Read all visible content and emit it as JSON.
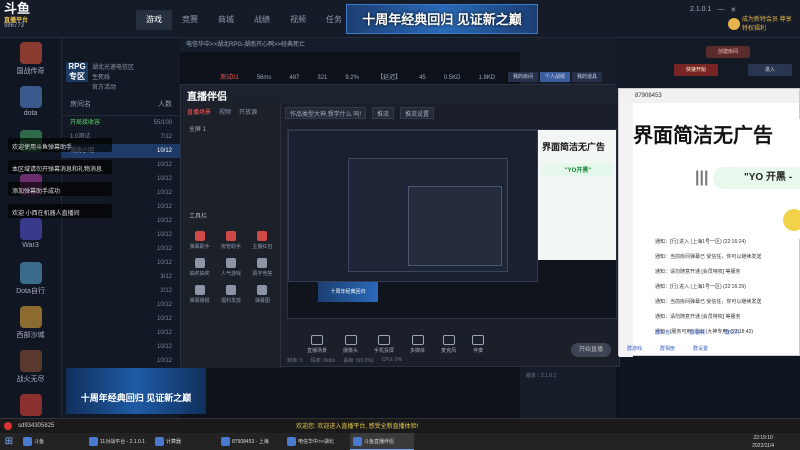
{
  "platform": {
    "logo_text": "斗鱼",
    "logo_sub": "直播平台",
    "user_id": "986773",
    "nav": [
      "",
      "",
      "游戏",
      "竞赛",
      "商城",
      "战绩",
      "视频",
      "任务"
    ],
    "active_nav_index": 2,
    "banner": "十周年经典回归 见证新之巅",
    "version": "2.1.0.1",
    "promo": "成为新特会员 尊享特权福利"
  },
  "games": [
    "国战传奇",
    "dota",
    "",
    "",
    "War3",
    "Dota自行",
    "西部沙城",
    "战火无尽",
    "传奇霸业"
  ],
  "rooms_top": {
    "badge": "RPG 专区",
    "line1": "湖北光速电信区",
    "line2": "生死线",
    "line3": "官方活动"
  },
  "rooms_header": {
    "name": "房间名",
    "count": "人数"
  },
  "rooms": [
    {
      "name": "开局接收容",
      "count": "55/100",
      "style": "green"
    },
    {
      "name": "1.0测试",
      "count": "7/12",
      "style": ""
    },
    {
      "name": "湖南小明",
      "count": "10/12",
      "style": "sel"
    },
    {
      "name": "",
      "count": "10/12",
      "style": ""
    },
    {
      "name": "",
      "count": "10/12",
      "style": ""
    },
    {
      "name": "",
      "count": "10/12",
      "style": ""
    },
    {
      "name": "",
      "count": "10/12",
      "style": ""
    },
    {
      "name": "",
      "count": "10/12",
      "style": ""
    },
    {
      "name": "",
      "count": "10/12",
      "style": ""
    },
    {
      "name": "",
      "count": "10/12",
      "style": ""
    },
    {
      "name": "",
      "count": "10/12",
      "style": ""
    },
    {
      "name": "",
      "count": "3/12",
      "style": ""
    },
    {
      "name": "",
      "count": "2/12",
      "style": ""
    },
    {
      "name": "",
      "count": "10/12",
      "style": ""
    },
    {
      "name": "",
      "count": "10/12",
      "style": ""
    },
    {
      "name": "",
      "count": "10/12",
      "style": ""
    },
    {
      "name": "",
      "count": "10/12",
      "style": ""
    },
    {
      "name": "",
      "count": "10/12",
      "style": ""
    }
  ],
  "chat": [
    "欢迎使用斗鱼弹幕助手",
    "本区域请勿开弹幕消息和礼物消息",
    "添加弹幕助手成功",
    "欢迎 小西在机器人直播间"
  ],
  "path_text": "电信华中>>湖北RPG-湖南开心鸭>>经典死亡",
  "status_bar": {
    "room": "测试01",
    "ping": "56ms",
    "a": "487",
    "b": "321",
    "c": "9.2%",
    "d": "【延迟】",
    "e": "45",
    "f": "0.5KD",
    "g": "1.8KD",
    "h": "254/秒"
  },
  "tool": {
    "logo": "直播伴侣",
    "tabs": [
      "直播场景",
      "视频",
      "开放源"
    ],
    "active_tab": 0,
    "scene": "全屏 1",
    "fields": [
      "作品类型大神,想学什么 吗!",
      "推流",
      "推流设置"
    ],
    "label_tools": "工具栏",
    "grid": [
      "弹幕助手",
      "房管助手",
      "主播红包",
      "抽奖抽奖",
      "人气游戏",
      "猜字竞答",
      "弹幕播报",
      "福利发放",
      "弹幕图"
    ],
    "bottom": [
      "直播场景",
      "摄像头",
      "手机投屏",
      "多媒体",
      "麦克风",
      "伴奏"
    ],
    "go_live": "开始直播",
    "stats": [
      "帧率: 0",
      "码率: 0kb/s",
      "丢帧: 0(0.0%)",
      "CPU: 0%"
    ]
  },
  "nested_ad": {
    "line": "界面简洁无广告",
    "pill": "\"YO开黑\""
  },
  "nested_banner": "十周年经典回归",
  "bottom_banner": "十周年经典回归 见证新之巅",
  "right_panel": {
    "tabs": [
      "我的房间",
      "个人战绩",
      "我的道具"
    ],
    "active_tab": 1,
    "version_text": "版本：2.1.0.1"
  },
  "wx": {
    "title": "87908453",
    "ad_line": "界面简洁无广告",
    "pill": "\"YO 开黑 -",
    "messages": [
      "通知：[行] 进入 (上海1号一区) (22:16:24)",
      "通知：当前房间弹幕已 受信任，你可以继续发送",
      "通知：请勿随意开通 [会员特权] 等服务",
      "通知：[行] 进入 (上海1号一区) (22:16:29)",
      "通知：当前房间弹幕已 受信任，你可以继续发送",
      "通知：请勿随意开通 [会员特权] 等服务",
      "通知：[服务可用] 退出 (大神专用) (22:18:42)"
    ],
    "bottom": [
      "群公告",
      "群视频",
      "群文件"
    ],
    "bottom2": [
      "群游戏",
      "群相册",
      "群设置"
    ]
  },
  "sidestrip": {
    "btn1": "创建房间",
    "btn2": "快速开始",
    "btn3": "进入"
  },
  "taskbar": {
    "user": "sd934305825",
    "msg": "欢迎您: 欢迎进入直播平台, 感受全新直播体验!",
    "apps": [
      "斗鱼",
      "11对战平台 - 2.1.0.1",
      "计算器",
      "87908453 - 上海",
      "电信华中>>湖北",
      "斗鱼直播伴侣"
    ],
    "active_app": 5,
    "time": "22:19:10",
    "date": "2022/11/4"
  }
}
